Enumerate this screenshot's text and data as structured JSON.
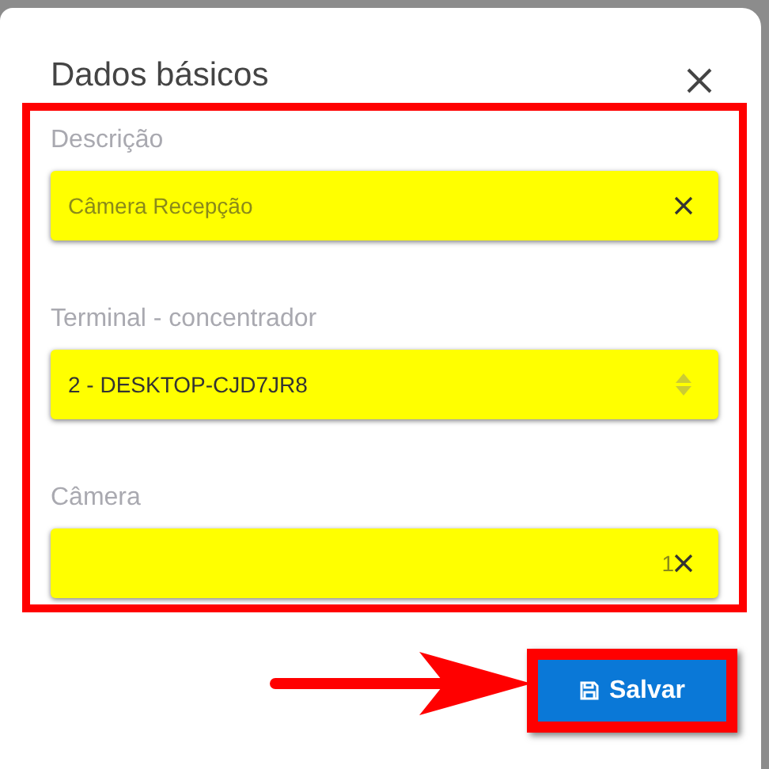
{
  "dialog": {
    "title": "Dados básicos",
    "fields": [
      {
        "kind": "text",
        "label": "Descrição",
        "value": "Câmera Recepção"
      },
      {
        "kind": "select",
        "label": "Terminal - concentrador",
        "value": "2 - DESKTOP-CJD7JR8"
      },
      {
        "kind": "multiselect",
        "label": "Câmera",
        "count": "1"
      }
    ],
    "save_button": {
      "label": "Salvar"
    }
  }
}
